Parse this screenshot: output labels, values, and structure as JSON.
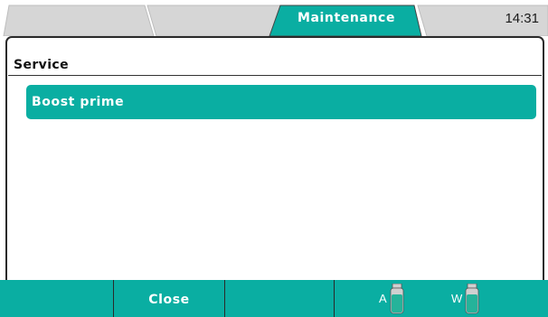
{
  "header": {
    "tabs": [
      {
        "label": "",
        "active": false
      },
      {
        "label": "",
        "active": false
      },
      {
        "label": "Maintenance",
        "active": true
      }
    ],
    "clock": "14:31"
  },
  "panel": {
    "section_title": "Service",
    "items": [
      {
        "label": "Boost prime"
      }
    ]
  },
  "footer": {
    "softkeys": [
      "",
      "Close",
      ""
    ],
    "bottles": [
      {
        "label": "A",
        "icon": "bottle-icon"
      },
      {
        "label": "W",
        "icon": "bottle-icon"
      }
    ]
  },
  "colors": {
    "accent": "#0aaea2",
    "inactive_tab": "#d6d6d6",
    "border": "#2a2a2a",
    "bottle_body": "#d0d0d0",
    "bottle_fill": "#25b39a"
  }
}
